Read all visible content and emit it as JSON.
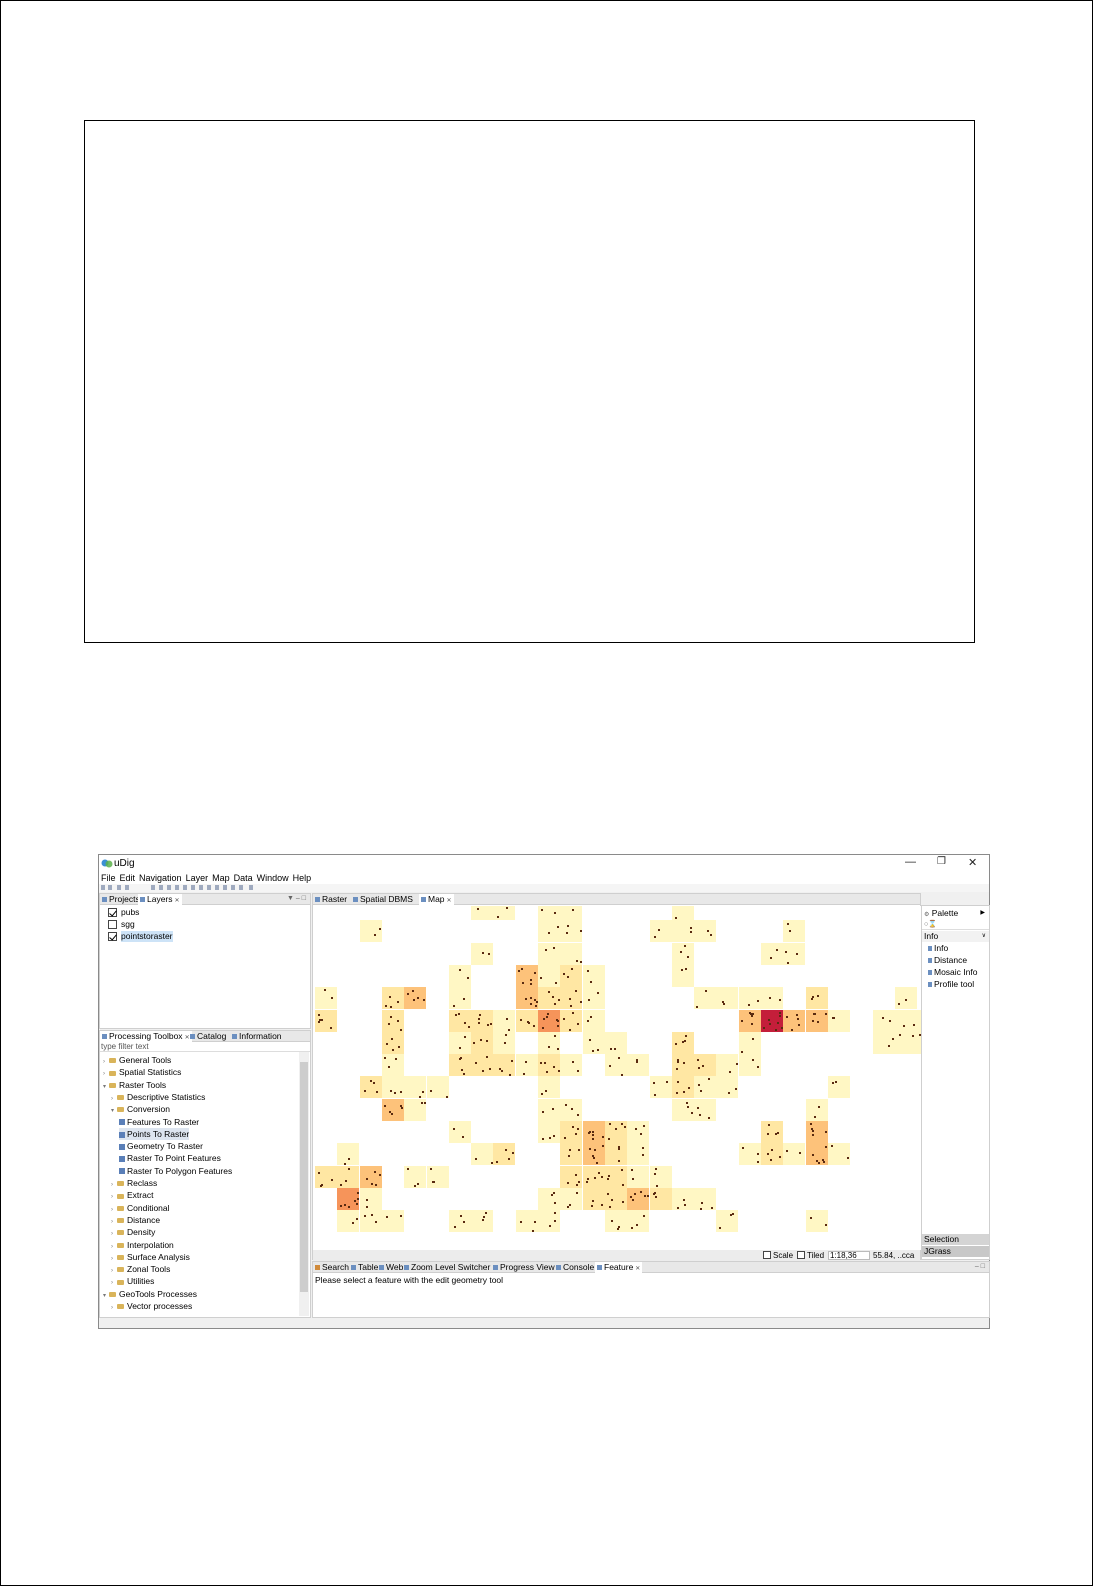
{
  "window": {
    "title": "uDig",
    "menu": [
      "File",
      "Edit",
      "Navigation",
      "Layer",
      "Map",
      "Data",
      "Window",
      "Help"
    ]
  },
  "layers_panel": {
    "tabs": [
      "Projects",
      "Layers"
    ],
    "layers": [
      {
        "name": "pubs",
        "checked": true,
        "selected": false
      },
      {
        "name": "sgg",
        "checked": false,
        "selected": false
      },
      {
        "name": "pointstoraster",
        "checked": true,
        "selected": true
      }
    ]
  },
  "toolbox_panel": {
    "tabs": [
      "Processing Toolbox",
      "Catalog",
      "Information"
    ],
    "filter_placeholder": "type filter text",
    "tree": [
      {
        "label": "General Tools",
        "depth": 0,
        "kind": "folder",
        "open": false
      },
      {
        "label": "Spatial Statistics",
        "depth": 0,
        "kind": "folder",
        "open": false
      },
      {
        "label": "Raster Tools",
        "depth": 0,
        "kind": "folder",
        "open": true
      },
      {
        "label": "Descriptive Statistics",
        "depth": 1,
        "kind": "folder",
        "open": false
      },
      {
        "label": "Conversion",
        "depth": 1,
        "kind": "folder",
        "open": true
      },
      {
        "label": "Features To Raster",
        "depth": 2,
        "kind": "tool"
      },
      {
        "label": "Points To Raster",
        "depth": 2,
        "kind": "tool",
        "selected": true
      },
      {
        "label": "Geometry To Raster",
        "depth": 2,
        "kind": "tool"
      },
      {
        "label": "Raster To Point Features",
        "depth": 2,
        "kind": "tool"
      },
      {
        "label": "Raster To Polygon Features",
        "depth": 2,
        "kind": "tool"
      },
      {
        "label": "Reclass",
        "depth": 1,
        "kind": "folder",
        "open": false
      },
      {
        "label": "Extract",
        "depth": 1,
        "kind": "folder",
        "open": false
      },
      {
        "label": "Conditional",
        "depth": 1,
        "kind": "folder",
        "open": false
      },
      {
        "label": "Distance",
        "depth": 1,
        "kind": "folder",
        "open": false
      },
      {
        "label": "Density",
        "depth": 1,
        "kind": "folder",
        "open": false
      },
      {
        "label": "Interpolation",
        "depth": 1,
        "kind": "folder",
        "open": false
      },
      {
        "label": "Surface Analysis",
        "depth": 1,
        "kind": "folder",
        "open": false
      },
      {
        "label": "Zonal Tools",
        "depth": 1,
        "kind": "folder",
        "open": false
      },
      {
        "label": "Utilities",
        "depth": 1,
        "kind": "folder",
        "open": false
      },
      {
        "label": "GeoTools Processes",
        "depth": 0,
        "kind": "folder",
        "open": true
      },
      {
        "label": "Vector processes",
        "depth": 1,
        "kind": "folder",
        "open": false
      }
    ]
  },
  "editor_tabs": [
    "Raster",
    "Spatial DBMS",
    "Map"
  ],
  "map_status": {
    "scale_label": "Scale",
    "tiled_label": "Tiled",
    "scale_value": "1:18,36",
    "coords": "55.84, ..cca"
  },
  "palette": {
    "title": "Palette",
    "section": "Info",
    "items": [
      "Info",
      "Distance",
      "Mosaic Info",
      "Profile tool"
    ],
    "selection_label": "Selection",
    "jgrass_label": "JGrass"
  },
  "bottom_tabs": [
    "Search",
    "Table",
    "Web",
    "Zoom Level Switcher",
    "Progress View",
    "Console",
    "Feature"
  ],
  "bottom_message": "Please select a feature with the edit geometry tool",
  "colors": {
    "heat_1": "#fff7c4",
    "heat_2": "#ffe7a3",
    "heat_3": "#fdc27a",
    "heat_4": "#f6945a",
    "heat_5": "#c41e3a"
  }
}
